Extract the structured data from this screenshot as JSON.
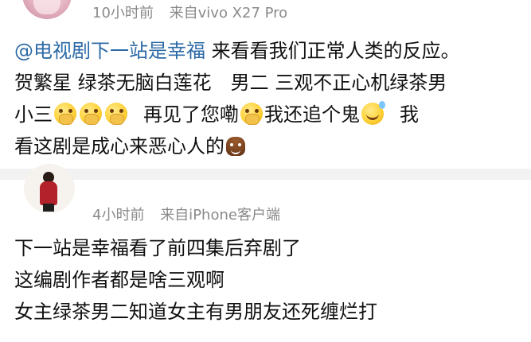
{
  "post1": {
    "time": "10小时前",
    "source": "来自vivo X27 Pro",
    "mention": "@电视剧下一站是幸福",
    "line1_rest": " 来看看我们正常人类的反应。",
    "line2": "贺繁星 绿茶无脑白莲花　男二 三观不正心机绿茶男",
    "line3_prefix": "小三",
    "line3_middle": "再见了您嘞",
    "line3_after": "我还追个鬼",
    "line3_end": "我",
    "line4": "看这剧是成心来恶心人的"
  },
  "post2": {
    "time": "4小时前",
    "source": "来自iPhone客户端",
    "line1": "下一站是幸福看了前四集后弃剧了",
    "line2": "这编剧作者都是啥三观啊",
    "line3": "女主绿茶男二知道女主有男朋友还死缠烂打"
  },
  "icons": {
    "emoji_cover": "hand-over-mouth-emoji",
    "emoji_sweat": "grin-sweat-emoji",
    "emoji_poop": "poop-emoji"
  }
}
